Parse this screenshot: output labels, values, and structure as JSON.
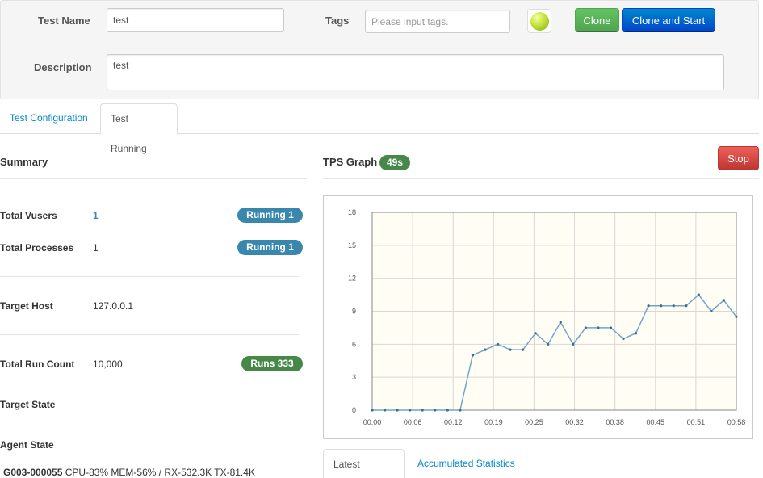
{
  "form": {
    "test_name_label": "Test Name",
    "test_name_value": "test",
    "tags_label": "Tags",
    "tags_placeholder": "Please input tags.",
    "description_label": "Description",
    "description_value": "test",
    "clone_label": "Clone",
    "clone_start_label": "Clone and Start",
    "status_color": "#b5d82e"
  },
  "tabs": {
    "config": "Test Configuration",
    "running": "Test Running"
  },
  "summary": {
    "title": "Summary",
    "vusers_label": "Total Vusers",
    "vusers_value": "1",
    "vusers_badge": "Running 1",
    "processes_label": "Total Processes",
    "processes_value": "1",
    "processes_badge": "Running 1",
    "host_label": "Target Host",
    "host_value": "127.0.0.1",
    "runcount_label": "Total Run Count",
    "runcount_value": "10,000",
    "runcount_badge": "Runs 333",
    "target_state_label": "Target State",
    "agent_state_label": "Agent State",
    "agent_name": "G003-000055",
    "agent_stats": " CPU-83% MEM-56% / RX-532.3K TX-81.4K"
  },
  "tps": {
    "title": "TPS Graph",
    "elapsed_badge": "49s",
    "stop_label": "Stop"
  },
  "subtabs": {
    "latest": "Latest Sample",
    "accumulated": "Accumulated Statistics"
  },
  "colors": {
    "line": "#6fa8c6",
    "plot_bg": "#fffdf4",
    "grid": "#d8d8d8"
  },
  "chart_data": {
    "type": "line",
    "title": "",
    "xlabel": "",
    "ylabel": "",
    "x_ticks": [
      "00:00",
      "00:06",
      "00:12",
      "00:19",
      "00:25",
      "00:32",
      "00:38",
      "00:45",
      "00:51",
      "00:58"
    ],
    "y_ticks": [
      0,
      3,
      6,
      9,
      12,
      15,
      18
    ],
    "ylim": [
      0,
      18
    ],
    "xlim": [
      0,
      58
    ],
    "grid": true,
    "series": [
      {
        "x": [
          0,
          2,
          4,
          6,
          8,
          10,
          12,
          14,
          16,
          18,
          20,
          22,
          24,
          26,
          28,
          30,
          32,
          34,
          36,
          38,
          40,
          42,
          44,
          46,
          48,
          50,
          52,
          54,
          56,
          58
        ],
        "y": [
          0,
          0,
          0,
          0,
          0,
          0,
          0,
          0,
          5,
          5.5,
          6,
          5.5,
          5.5,
          7,
          6,
          8,
          6,
          7.5,
          7.5,
          7.5,
          6.5,
          7,
          9.5,
          9.5,
          9.5,
          9.5,
          10.5,
          9,
          10,
          8.5
        ]
      }
    ]
  }
}
